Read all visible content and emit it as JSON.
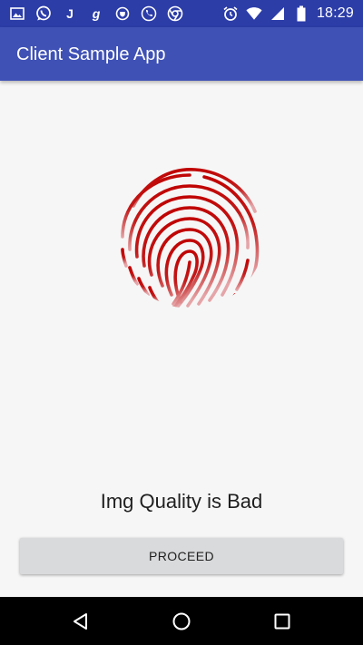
{
  "status_bar": {
    "left_icons": [
      "gallery-icon",
      "whatsapp-icon",
      "j-app-icon",
      "g-app-icon",
      "shield-icon",
      "phone-icon",
      "chrome-icon"
    ],
    "j_letter": "J",
    "g_letter": "g",
    "right_icons": [
      "alarm-icon",
      "wifi-icon",
      "signal-icon",
      "battery-icon"
    ],
    "time": "18:29"
  },
  "app_bar": {
    "title": "Client Sample App"
  },
  "main": {
    "fingerprint_icon": "fingerprint-icon",
    "fingerprint_color": "#c00000",
    "message": "Img Quality is Bad",
    "proceed_label": "PROCEED"
  },
  "nav_bar": {
    "buttons": [
      "back-icon",
      "home-icon",
      "recents-icon"
    ]
  }
}
